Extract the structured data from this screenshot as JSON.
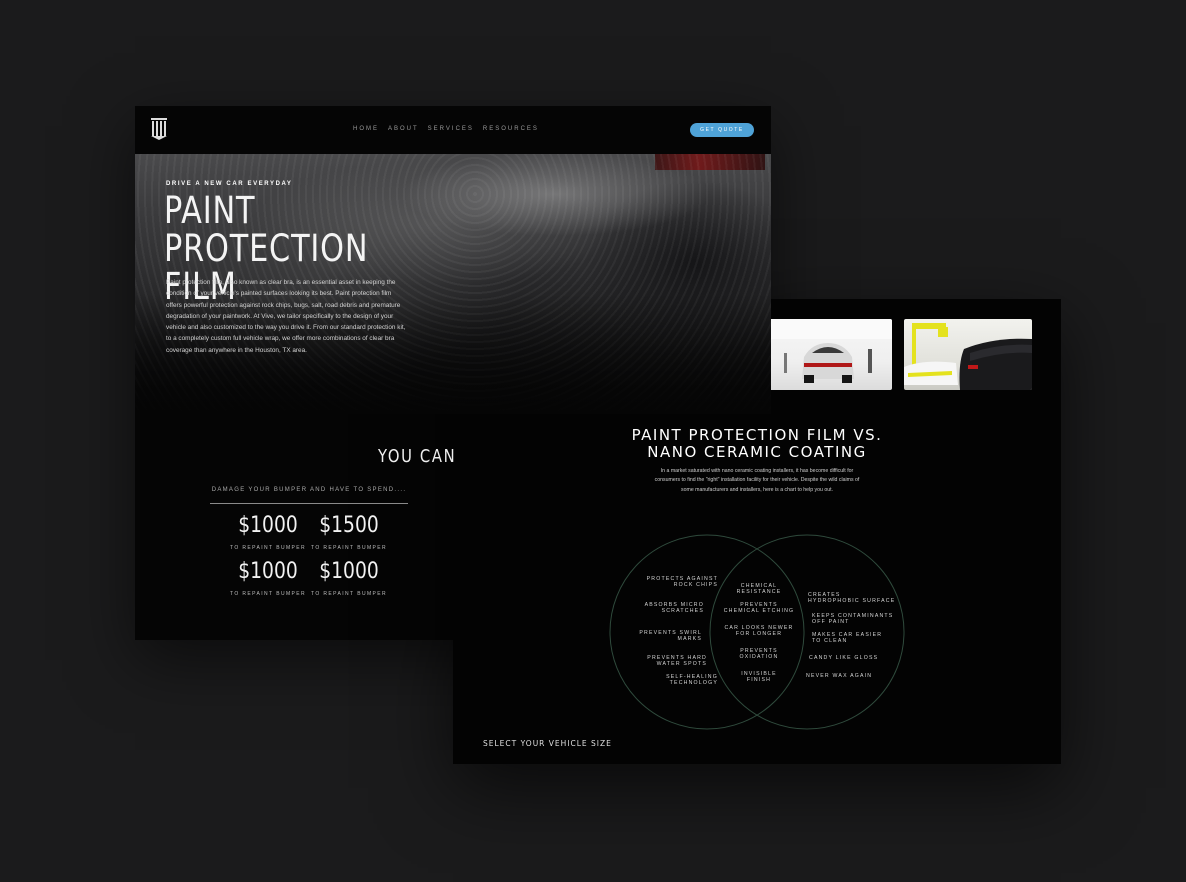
{
  "back_page": {
    "nav": {
      "links": [
        "HOME",
        "ABOUT",
        "SERVICES",
        "RESOURCES"
      ],
      "cta": "GET QUOTE"
    },
    "hero": {
      "kicker": "DRIVE A NEW CAR EVERYDAY",
      "title_line1": "PAINT PROTECTION",
      "title_line2": "FILM",
      "body": "Paint protection film, also known as clear bra, is an essential asset in keeping the condition of your vehicle's painted surfaces looking its best. Paint protection film offers powerful protection against rock chips, bugs, salt, road debris and premature degradation of your paintwork. At Vive, we tailor specifically to the design of your vehicle and also customized to the way you drive it. From our standard protection kit, to a completely custom full vehicle wrap, we offer more combinations of clear bra coverage than anywhere in the Houston, TX area."
    },
    "savings": {
      "heading": "YOU CAN",
      "subtext": "DAMAGE YOUR BUMPER AND HAVE TO SPEND....",
      "prices": [
        {
          "amount": "$1000",
          "label": "TO REPAINT BUMPER"
        },
        {
          "amount": "$1500",
          "label": "TO REPAINT BUMPER"
        },
        {
          "amount": "$1000",
          "label": "TO REPAINT BUMPER"
        },
        {
          "amount": "$1000",
          "label": "TO REPAINT BUMPER"
        }
      ]
    }
  },
  "front_page": {
    "comparison": {
      "title_line1": "PAINT PROTECTION FILM VS.",
      "title_line2": "NANO CERAMIC COATING",
      "body": "In a market saturated with nano ceramic coating installers, it has become difficult for consumers to find the \"right\" installation facility for their vehicle. Despite the wild claims of some manufacturers and installers, here is a chart to help you out."
    },
    "venn": {
      "left": [
        [
          "PROTECTS AGAINST",
          "ROCK CHIPS"
        ],
        [
          "ABSORBS MICRO",
          "SCRATCHES"
        ],
        [
          "PREVENTS SWIRL",
          "MARKS"
        ],
        [
          "PREVENTS HARD",
          "WATER SPOTS"
        ],
        [
          "SELF-HEALING",
          "TECHNOLOGY"
        ]
      ],
      "center": [
        [
          "CHEMICAL",
          "RESISTANCE"
        ],
        [
          "PREVENTS",
          "CHEMICAL ETCHING"
        ],
        [
          "CAR LOOKS NEWER",
          "FOR LONGER"
        ],
        [
          "PREVENTS",
          "OXIDATION"
        ],
        [
          "INVISIBLE",
          "FINISH"
        ]
      ],
      "right": [
        [
          "CREATES",
          "HYDROPHOBIC SURFACE"
        ],
        [
          "KEEPS CONTAMINANTS",
          "OFF PAINT"
        ],
        [
          "MAKES CAR EASIER",
          "TO CLEAN"
        ],
        [
          "CANDY LIKE GLOSS"
        ],
        [
          "NEVER WAX AGAIN"
        ]
      ]
    },
    "select_size": "SELECT YOUR VEHICLE SIZE"
  },
  "colors": {
    "background": "#1b1b1c",
    "panel": "#050505",
    "accent": "#4fa3d8",
    "venn_stroke": "#2f4a3c"
  },
  "icons": [
    "vive-logo-icon"
  ]
}
